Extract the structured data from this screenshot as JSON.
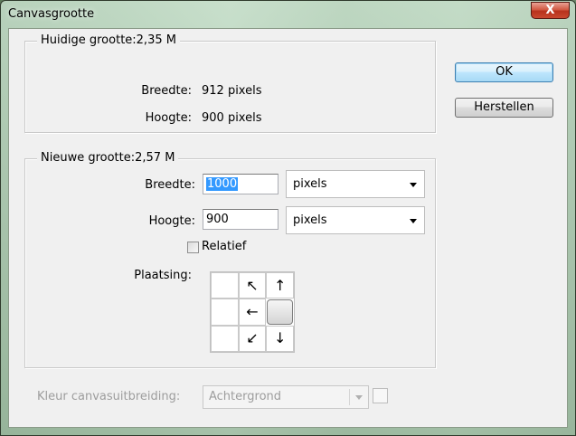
{
  "window": {
    "title": "Canvasgrootte",
    "close_glyph": "X"
  },
  "current_size": {
    "legend": "Huidige grootte:2,35 M",
    "width_label": "Breedte:",
    "width_value": "912 pixels",
    "height_label": "Hoogte:",
    "height_value": "900 pixels"
  },
  "new_size": {
    "legend": "Nieuwe grootte:2,57 M",
    "width_label": "Breedte:",
    "width_value": "1000",
    "width_unit": "pixels",
    "height_label": "Hoogte:",
    "height_value": "900",
    "height_unit": "pixels",
    "relative_label": "Relatief",
    "relative_checked": false,
    "anchor_label": "Plaatsing:",
    "anchor_cells": [
      "",
      "↖",
      "↑",
      "",
      "←",
      "",
      "",
      "↙",
      "↓"
    ],
    "anchor_selected_index": 5
  },
  "buttons": {
    "ok": "OK",
    "reset": "Herstellen"
  },
  "extension": {
    "label": "Kleur canvasuitbreiding:",
    "value": "Achtergrond"
  },
  "icons": {
    "close": "close-icon",
    "dropdown": "chevron-down-icon"
  }
}
